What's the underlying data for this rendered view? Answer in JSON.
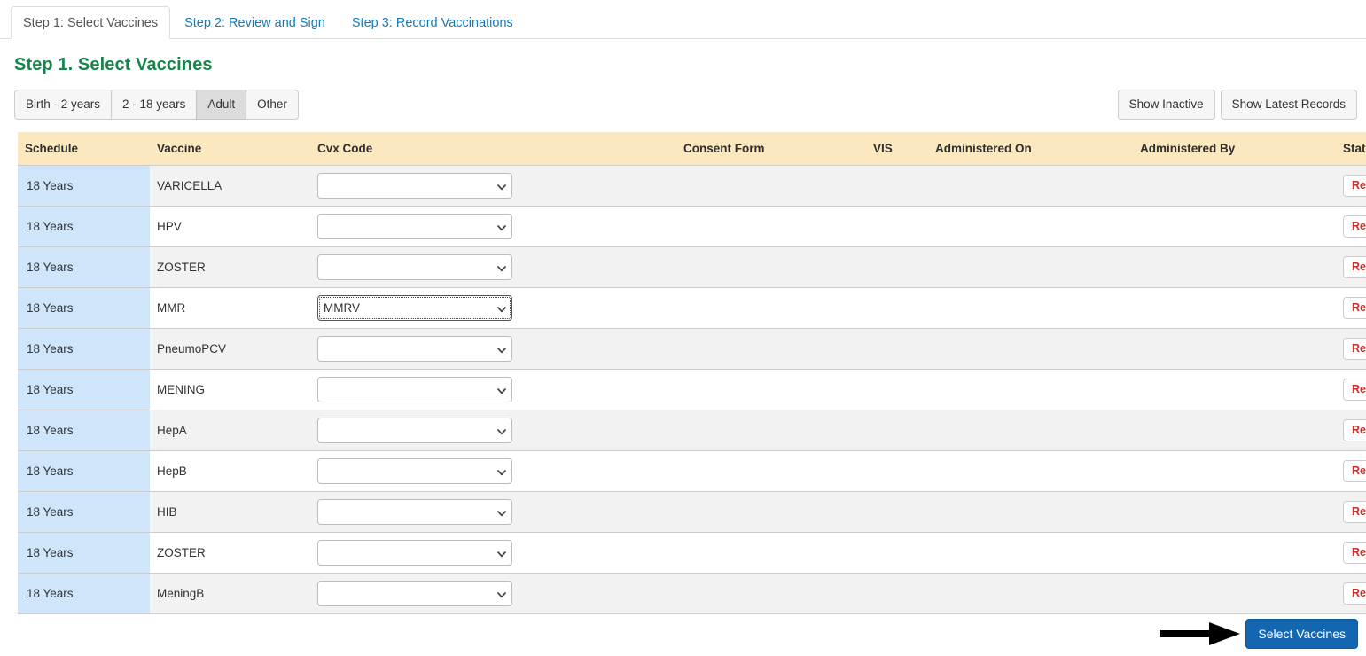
{
  "tabs": [
    {
      "label": "Step 1: Select Vaccines",
      "active": true
    },
    {
      "label": "Step 2: Review and Sign",
      "active": false
    },
    {
      "label": "Step 3: Record Vaccinations",
      "active": false
    }
  ],
  "page": {
    "heading": "Step 1. Select Vaccines",
    "heading_color": "#17864a"
  },
  "filters": {
    "age_groups": [
      {
        "label": "Birth - 2 years",
        "active": false
      },
      {
        "label": "2 - 18 years",
        "active": false
      },
      {
        "label": "Adult",
        "active": true
      },
      {
        "label": "Other",
        "active": false
      }
    ],
    "show_inactive_label": "Show Inactive",
    "show_latest_records_label": "Show Latest Records"
  },
  "table": {
    "columns": [
      "Schedule",
      "Vaccine",
      "Cvx Code",
      "Consent Form",
      "VIS",
      "Administered On",
      "Administered By",
      "Status"
    ],
    "header_bg": "#fbe8bf",
    "schedule_cell_bg": "#cfe6fa",
    "rows": [
      {
        "schedule": "18 Years",
        "vaccine": "VARICELLA",
        "cvx_value": "",
        "cvx_focused": false,
        "consent_form": "",
        "vis": "",
        "administered_on": "",
        "administered_by": "",
        "status_label": "Refuse"
      },
      {
        "schedule": "18 Years",
        "vaccine": "HPV",
        "cvx_value": "",
        "cvx_focused": false,
        "consent_form": "",
        "vis": "",
        "administered_on": "",
        "administered_by": "",
        "status_label": "Refuse"
      },
      {
        "schedule": "18 Years",
        "vaccine": "ZOSTER",
        "cvx_value": "",
        "cvx_focused": false,
        "consent_form": "",
        "vis": "",
        "administered_on": "",
        "administered_by": "",
        "status_label": "Refuse"
      },
      {
        "schedule": "18 Years",
        "vaccine": "MMR",
        "cvx_value": "MMRV",
        "cvx_focused": true,
        "consent_form": "",
        "vis": "",
        "administered_on": "",
        "administered_by": "",
        "status_label": "Refuse"
      },
      {
        "schedule": "18 Years",
        "vaccine": "PneumoPCV",
        "cvx_value": "",
        "cvx_focused": false,
        "consent_form": "",
        "vis": "",
        "administered_on": "",
        "administered_by": "",
        "status_label": "Refuse"
      },
      {
        "schedule": "18 Years",
        "vaccine": "MENING",
        "cvx_value": "",
        "cvx_focused": false,
        "consent_form": "",
        "vis": "",
        "administered_on": "",
        "administered_by": "",
        "status_label": "Refuse"
      },
      {
        "schedule": "18 Years",
        "vaccine": "HepA",
        "cvx_value": "",
        "cvx_focused": false,
        "consent_form": "",
        "vis": "",
        "administered_on": "",
        "administered_by": "",
        "status_label": "Refuse"
      },
      {
        "schedule": "18 Years",
        "vaccine": "HepB",
        "cvx_value": "",
        "cvx_focused": false,
        "consent_form": "",
        "vis": "",
        "administered_on": "",
        "administered_by": "",
        "status_label": "Refuse"
      },
      {
        "schedule": "18 Years",
        "vaccine": "HIB",
        "cvx_value": "",
        "cvx_focused": false,
        "consent_form": "",
        "vis": "",
        "administered_on": "",
        "administered_by": "",
        "status_label": "Refuse"
      },
      {
        "schedule": "18 Years",
        "vaccine": "ZOSTER",
        "cvx_value": "",
        "cvx_focused": false,
        "consent_form": "",
        "vis": "",
        "administered_on": "",
        "administered_by": "",
        "status_label": "Refuse"
      },
      {
        "schedule": "18 Years",
        "vaccine": "MeningB",
        "cvx_value": "",
        "cvx_focused": false,
        "consent_form": "",
        "vis": "",
        "administered_on": "",
        "administered_by": "",
        "status_label": "Refuse"
      }
    ]
  },
  "footer": {
    "annotation_icon": "right-arrow-annotation",
    "submit_label": "Select Vaccines",
    "submit_color": "#1366b0"
  }
}
